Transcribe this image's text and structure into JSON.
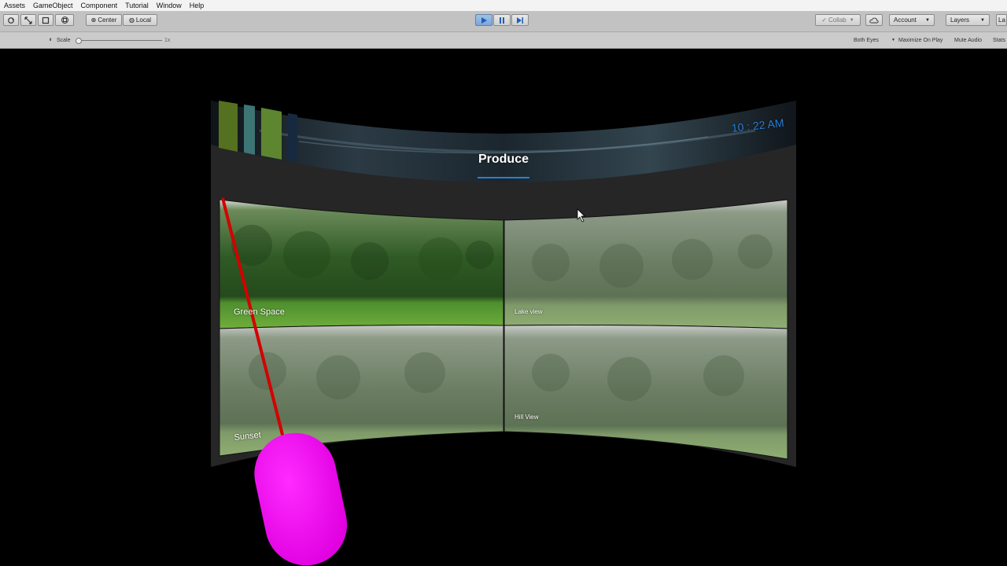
{
  "menu": [
    "Assets",
    "GameObject",
    "Component",
    "Tutorial",
    "Window",
    "Help"
  ],
  "toolbar": {
    "center_label": "Center",
    "local_label": "Local",
    "collab_label": "Collab",
    "account_label": "Account",
    "layers_label": "Layers",
    "layout_label": "La"
  },
  "gamebar": {
    "scale_label": "Scale",
    "scale_value": "1x",
    "both_eyes": "Both Eyes",
    "maximize": "Maximize On Play",
    "mute": "Mute Audio",
    "stats": "Stats"
  },
  "scene": {
    "time": "10 : 22 AM",
    "title": "Produce",
    "tiles": [
      "Green Space",
      "Lake view",
      "Sunset",
      "Hill View"
    ]
  },
  "colors": {
    "accent_blue": "#2a7fd4",
    "controller": "#ee00ee",
    "laser": "#d40000",
    "panel": "#262626"
  }
}
